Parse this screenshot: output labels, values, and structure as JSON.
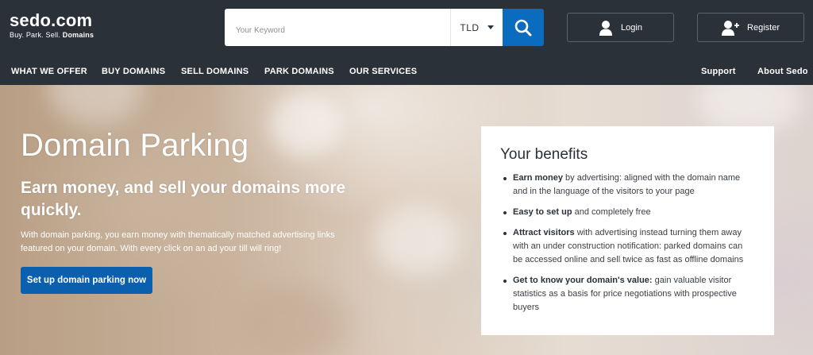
{
  "header": {
    "logo_main": "sedo.com",
    "logo_tag_plain": "Buy. Park. Sell. ",
    "logo_tag_bold": "Domains",
    "search_placeholder": "Your Keyword",
    "tld_label": "TLD",
    "login_label": "Login",
    "register_label": "Register"
  },
  "nav": {
    "left": [
      "WHAT WE OFFER",
      "BUY DOMAINS",
      "SELL DOMAINS",
      "PARK DOMAINS",
      "OUR SERVICES"
    ],
    "right": [
      "Support",
      "About Sedo"
    ]
  },
  "hero": {
    "title": "Domain Parking",
    "subtitle": "Earn money, and sell your domains more quickly.",
    "text": "With domain parking, you earn money with thematically matched advertising links featured on your domain. With every click on an ad your till will ring!",
    "cta_label": "Set up domain parking now"
  },
  "benefits": {
    "title": "Your benefits",
    "items": [
      {
        "bold": "Earn money",
        "text": " by advertising: aligned with the domain name and in the language of the visitors to your page"
      },
      {
        "bold": "Easy to set up",
        "text": " and completely free"
      },
      {
        "bold": "Attract visitors",
        "text": " with advertising instead turning them away with an under construction notification: parked domains can be accessed online and sell twice as fast as offline domains"
      },
      {
        "bold": "Get to know your domain's value:",
        "text": " gain valuable visitor statistics as a basis for price negotiations with prospective buyers"
      }
    ]
  },
  "colors": {
    "header_bg": "#2b3139",
    "accent_blue": "#0a6bbf",
    "cta_blue": "#0a5fae"
  },
  "icons": [
    "search-icon",
    "tld-caret-icon",
    "user-icon",
    "user-add-icon"
  ]
}
